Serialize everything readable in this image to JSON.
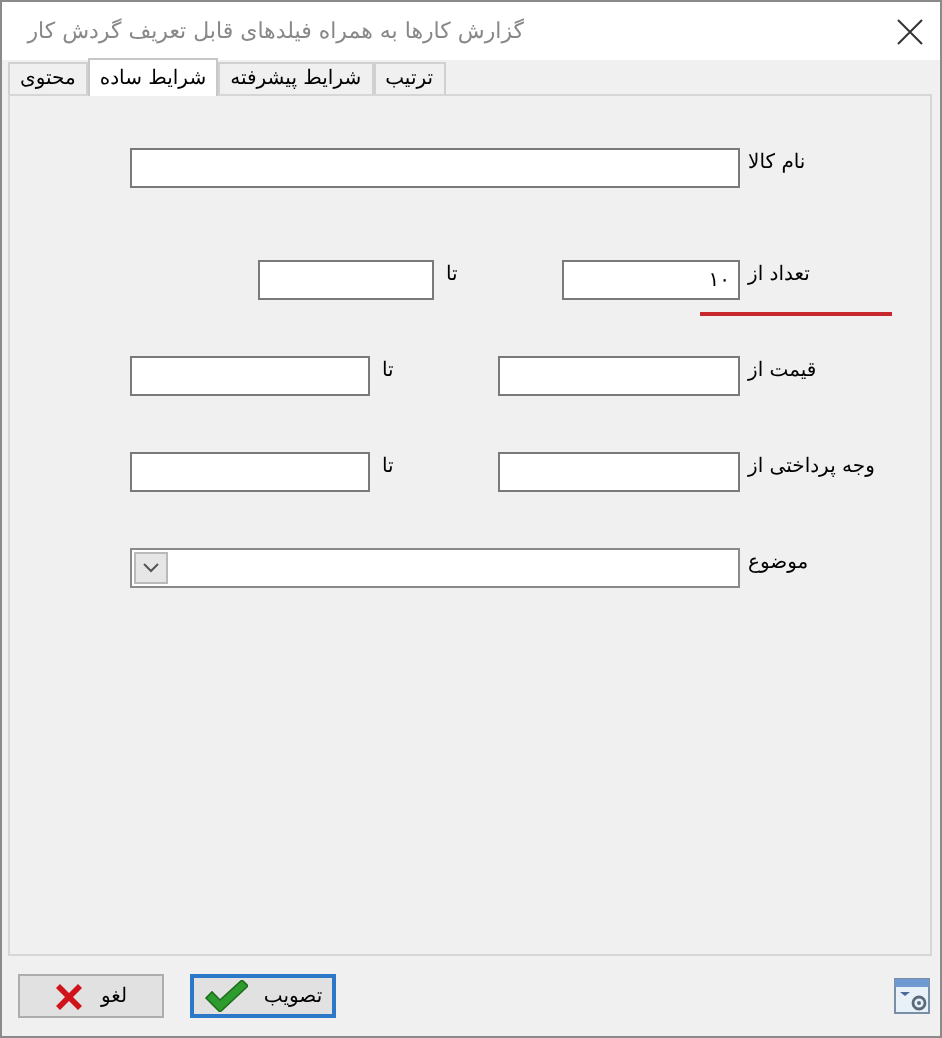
{
  "window": {
    "title": "گزارش کارها به همراه فیلدهای قابل تعریف گردش کار"
  },
  "tabs": [
    {
      "label": "ترتیب",
      "selected": false
    },
    {
      "label": "شرایط پیشرفته",
      "selected": false
    },
    {
      "label": "شرایط ساده",
      "selected": true
    },
    {
      "label": "محتوی",
      "selected": false
    }
  ],
  "fields": [
    {
      "kind": "text",
      "label": "نام کالا"
    },
    {
      "kind": "short-range",
      "label": "تعداد از",
      "from_value": "۱۰",
      "to_label": "تا"
    },
    {
      "kind": "range",
      "label": "قیمت از",
      "to_label": "تا"
    },
    {
      "kind": "range",
      "label": "وجه پرداختی از",
      "to_label": "تا"
    },
    {
      "kind": "combo",
      "label": "موضوع"
    }
  ],
  "buttons": [
    {
      "kind": "ok",
      "label": "تصویب",
      "focused": true
    },
    {
      "kind": "cancel",
      "label": "لغو",
      "focused": false
    }
  ]
}
